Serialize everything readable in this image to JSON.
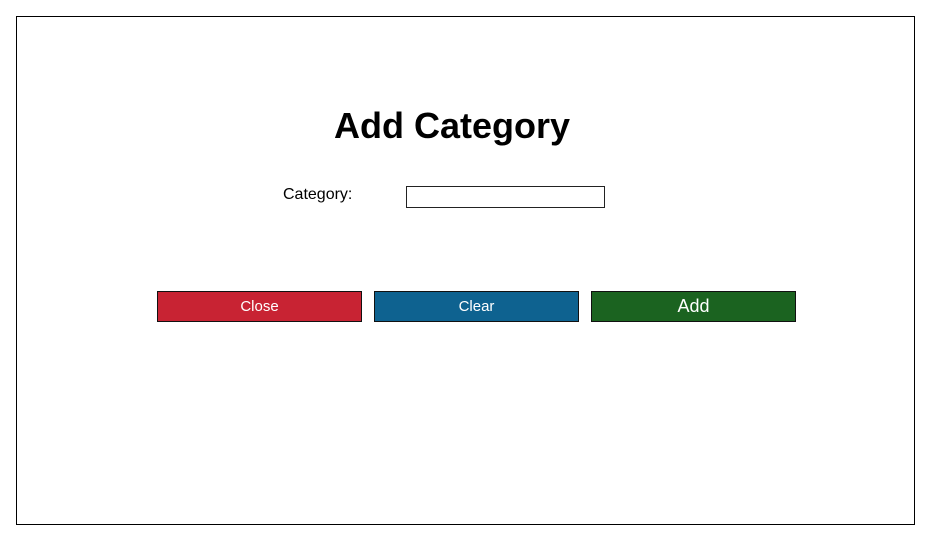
{
  "dialog": {
    "title": "Add Category",
    "category_label": "Category:",
    "category_value": "",
    "category_placeholder": ""
  },
  "buttons": {
    "close_label": "Close",
    "clear_label": "Clear",
    "add_label": "Add"
  },
  "colors": {
    "close": "#c82333",
    "clear": "#0e6290",
    "add": "#1b6320"
  }
}
